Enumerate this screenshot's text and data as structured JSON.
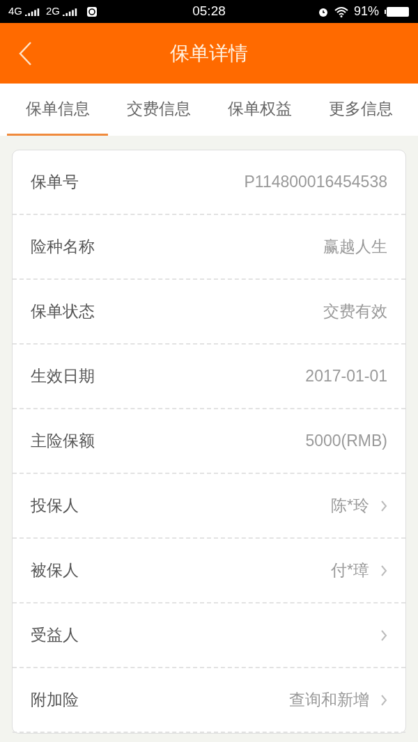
{
  "status_bar": {
    "network_1": "4G",
    "network_2": "2G",
    "time": "05:28",
    "battery": "91%"
  },
  "header": {
    "title": "保单详情"
  },
  "tabs": [
    {
      "label": "保单信息",
      "selected": true
    },
    {
      "label": "交费信息",
      "selected": false
    },
    {
      "label": "保单权益",
      "selected": false
    },
    {
      "label": "更多信息",
      "selected": false
    }
  ],
  "rows": [
    {
      "kind": "plain",
      "label": "保单号",
      "value": "P114800016454538"
    },
    {
      "kind": "plain",
      "label": "险种名称",
      "value": "赢越人生"
    },
    {
      "kind": "plain",
      "label": "保单状态",
      "value": "交费有效"
    },
    {
      "kind": "plain",
      "label": "生效日期",
      "value": "2017-01-01"
    },
    {
      "kind": "plain",
      "label": "主险保额",
      "value": "5000(RMB)"
    },
    {
      "kind": "link",
      "label": "投保人",
      "value": "陈*玲"
    },
    {
      "kind": "link",
      "label": "被保人",
      "value": "付*璋"
    },
    {
      "kind": "link",
      "label": "受益人"
    },
    {
      "kind": "link",
      "label": "附加险",
      "value": "查询和新增"
    }
  ]
}
